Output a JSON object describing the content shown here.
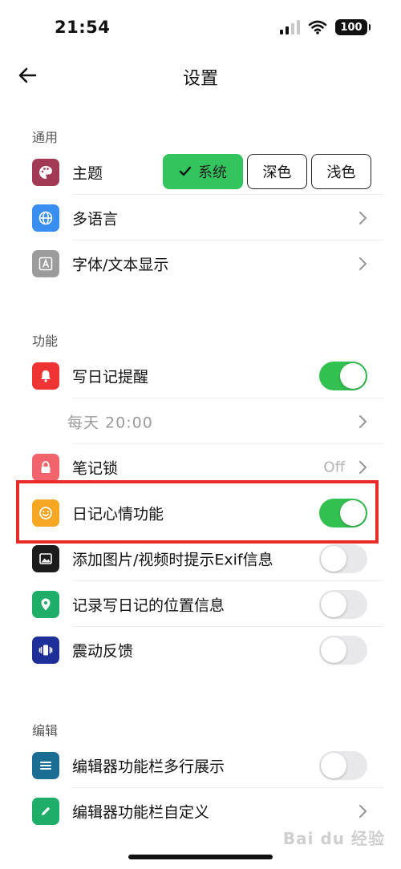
{
  "status_bar": {
    "time": "21:54",
    "battery": "100"
  },
  "nav": {
    "title": "设置"
  },
  "sections": {
    "general": "通用",
    "features": "功能",
    "editing": "编辑"
  },
  "rows": {
    "theme": {
      "label": "主题",
      "icon": "palette-icon",
      "color": "#a23a55"
    },
    "language": {
      "label": "多语言",
      "icon": "globe-icon",
      "color": "#3a8ef0"
    },
    "font": {
      "label": "字体/文本显示",
      "icon": "font-a-icon",
      "color": "#9b9b9b"
    },
    "reminder": {
      "label": "写日记提醒",
      "icon": "bell-icon",
      "color": "#ef3434",
      "enabled": true
    },
    "reminder_time": {
      "label": "每天  20:00"
    },
    "note_lock": {
      "label": "笔记锁",
      "value": "Off",
      "icon": "lock-icon",
      "color": "#f2646b"
    },
    "mood": {
      "label": "日记心情功能",
      "icon": "smile-icon",
      "color": "#f5a623",
      "enabled": true
    },
    "exif": {
      "label": "添加图片/视频时提示Exif信息",
      "icon": "image-icon",
      "color": "#1c1c1c",
      "enabled": false
    },
    "location": {
      "label": "记录写日记的位置信息",
      "icon": "location-pin-icon",
      "color": "#1fae6a",
      "enabled": false
    },
    "haptic": {
      "label": "震动反馈",
      "icon": "vibration-icon",
      "color": "#1f2f9a",
      "enabled": false
    },
    "toolbar_multiline": {
      "label": "编辑器功能栏多行展示",
      "icon": "menu-lines-icon",
      "color": "#1a6e93",
      "enabled": false
    },
    "toolbar_custom": {
      "label": "编辑器功能栏自定义",
      "icon": "pencil-icon",
      "color": "#1fae6a"
    }
  },
  "theme_options": {
    "system": "系统",
    "dark": "深色",
    "light": "浅色",
    "selected": "system"
  },
  "colors": {
    "accent_green": "#33c45d",
    "toggle_on": "#32c150",
    "highlight_red": "#e92a26"
  },
  "watermark": "Bai du 经验"
}
